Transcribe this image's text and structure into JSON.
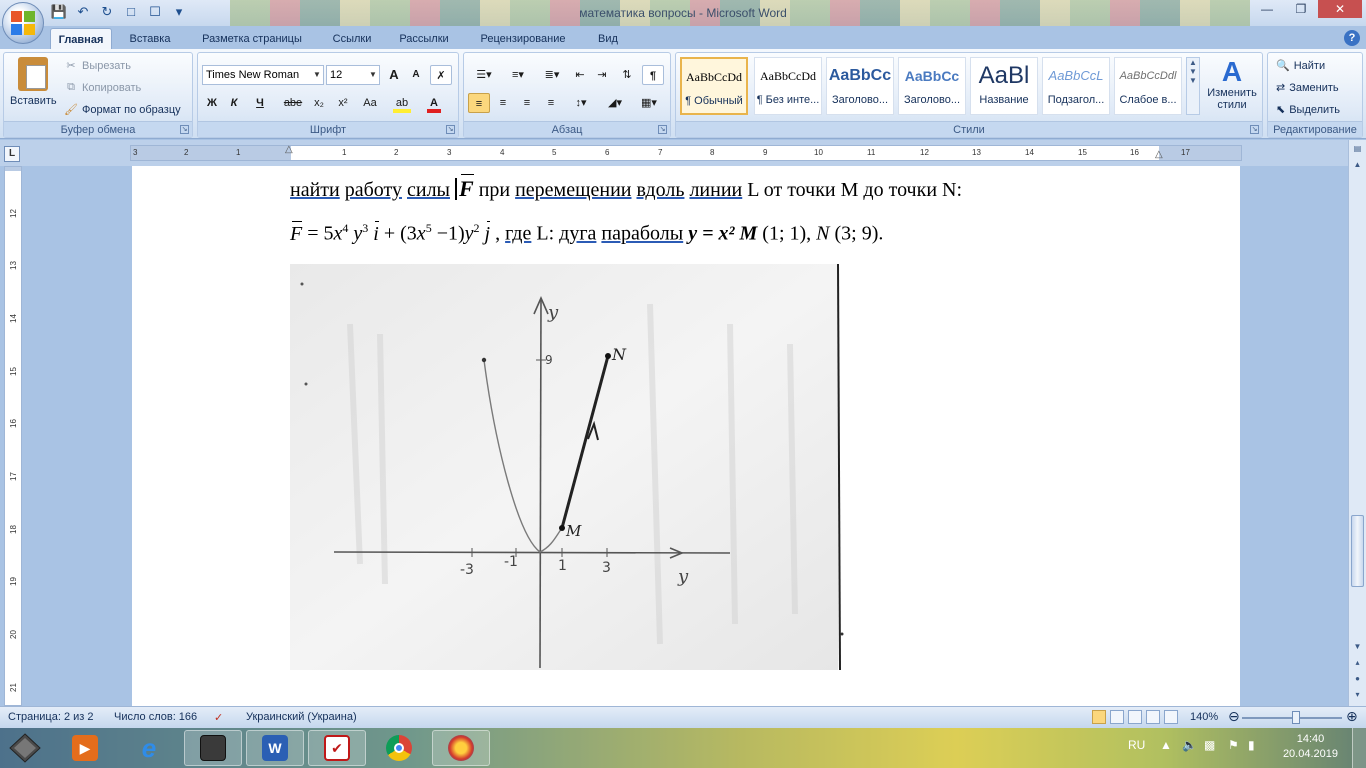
{
  "window": {
    "title": "математика вопросы - Microsoft Word"
  },
  "tabs": [
    "Главная",
    "Вставка",
    "Разметка страницы",
    "Ссылки",
    "Рассылки",
    "Рецензирование",
    "Вид"
  ],
  "clipboard": {
    "paste": "Вставить",
    "cut": "Вырезать",
    "copy": "Копировать",
    "format_painter": "Формат по образцу",
    "label": "Буфер обмена"
  },
  "font": {
    "name": "Times New Roman",
    "size": "12",
    "bold": "Ж",
    "italic": "К",
    "underline": "Ч",
    "strike": "abe",
    "subscript": "x₂",
    "superscript": "x²",
    "case": "Aa",
    "grow": "A",
    "shrink": "A",
    "label": "Шрифт"
  },
  "paragraph": {
    "label": "Абзац",
    "show_marks": "¶"
  },
  "styles": {
    "items": [
      {
        "sample": "AaBbCcDd",
        "name": "¶ Обычный"
      },
      {
        "sample": "AaBbCcDd",
        "name": "¶ Без инте..."
      },
      {
        "sample": "AaBbCc",
        "name": "Заголово..."
      },
      {
        "sample": "AaBbCc",
        "name": "Заголово..."
      },
      {
        "sample": "AaBl",
        "name": "Название"
      },
      {
        "sample": "AaBbCcL",
        "name": "Подзагол..."
      },
      {
        "sample": "AaBbCcDdl",
        "name": "Слабое в..."
      }
    ],
    "change": "Изменить стили",
    "label": "Стили"
  },
  "editing": {
    "find": "Найти",
    "replace": "Заменить",
    "select": "Выделить",
    "label": "Редактирование"
  },
  "ruler": {
    "h_ticks": [
      "3",
      "2",
      "1",
      "1",
      "2",
      "3",
      "4",
      "5",
      "6",
      "7",
      "8",
      "9",
      "10",
      "11",
      "12",
      "13",
      "14",
      "15",
      "16",
      "17"
    ],
    "v_ticks": [
      "12",
      "13",
      "14",
      "15",
      "16",
      "17",
      "18",
      "19",
      "20",
      "21"
    ],
    "tab_selector": "L"
  },
  "document": {
    "line1": {
      "t1": "найти",
      "t2": "работу",
      "t3": "силы",
      "vec": "F",
      "t4": "при",
      "t5": "перемещении",
      "t6": "вдоль",
      "t7": "линии",
      "t8": "L от  точки M  до точки N:"
    },
    "line2": {
      "vec_f": "F",
      "eq": " = 5",
      "x1": "x",
      "p4": "4",
      "y1": "y",
      "p3": "3",
      "vec_i": "i",
      "plus": " + (3",
      "x2": "x",
      "p5": "5",
      "minus": " −1)",
      "y2": "y",
      "p2": "2",
      "vec_j": "j",
      "comma": " , ",
      "where": "где",
      "l": " L: ",
      "arc": "дуга",
      "parab": "параболы",
      "y_eq": " y = x²",
      "m": " M",
      "m_coords": " (1; 1), ",
      "n": "N",
      "n_coords": " (3; 9)."
    },
    "photo": {
      "y_label": "y",
      "x_label": "y",
      "nine": "9",
      "m": "M",
      "n": "N",
      "xticks": [
        "-3",
        "-1",
        "1",
        "3"
      ]
    }
  },
  "status": {
    "page": "Страница: 2 из 2",
    "words": "Число слов: 166",
    "language": "Украинский (Украина)",
    "zoom": "140%"
  },
  "taskbar": {
    "lang": "RU",
    "time": "14:40",
    "date": "20.04.2019"
  }
}
